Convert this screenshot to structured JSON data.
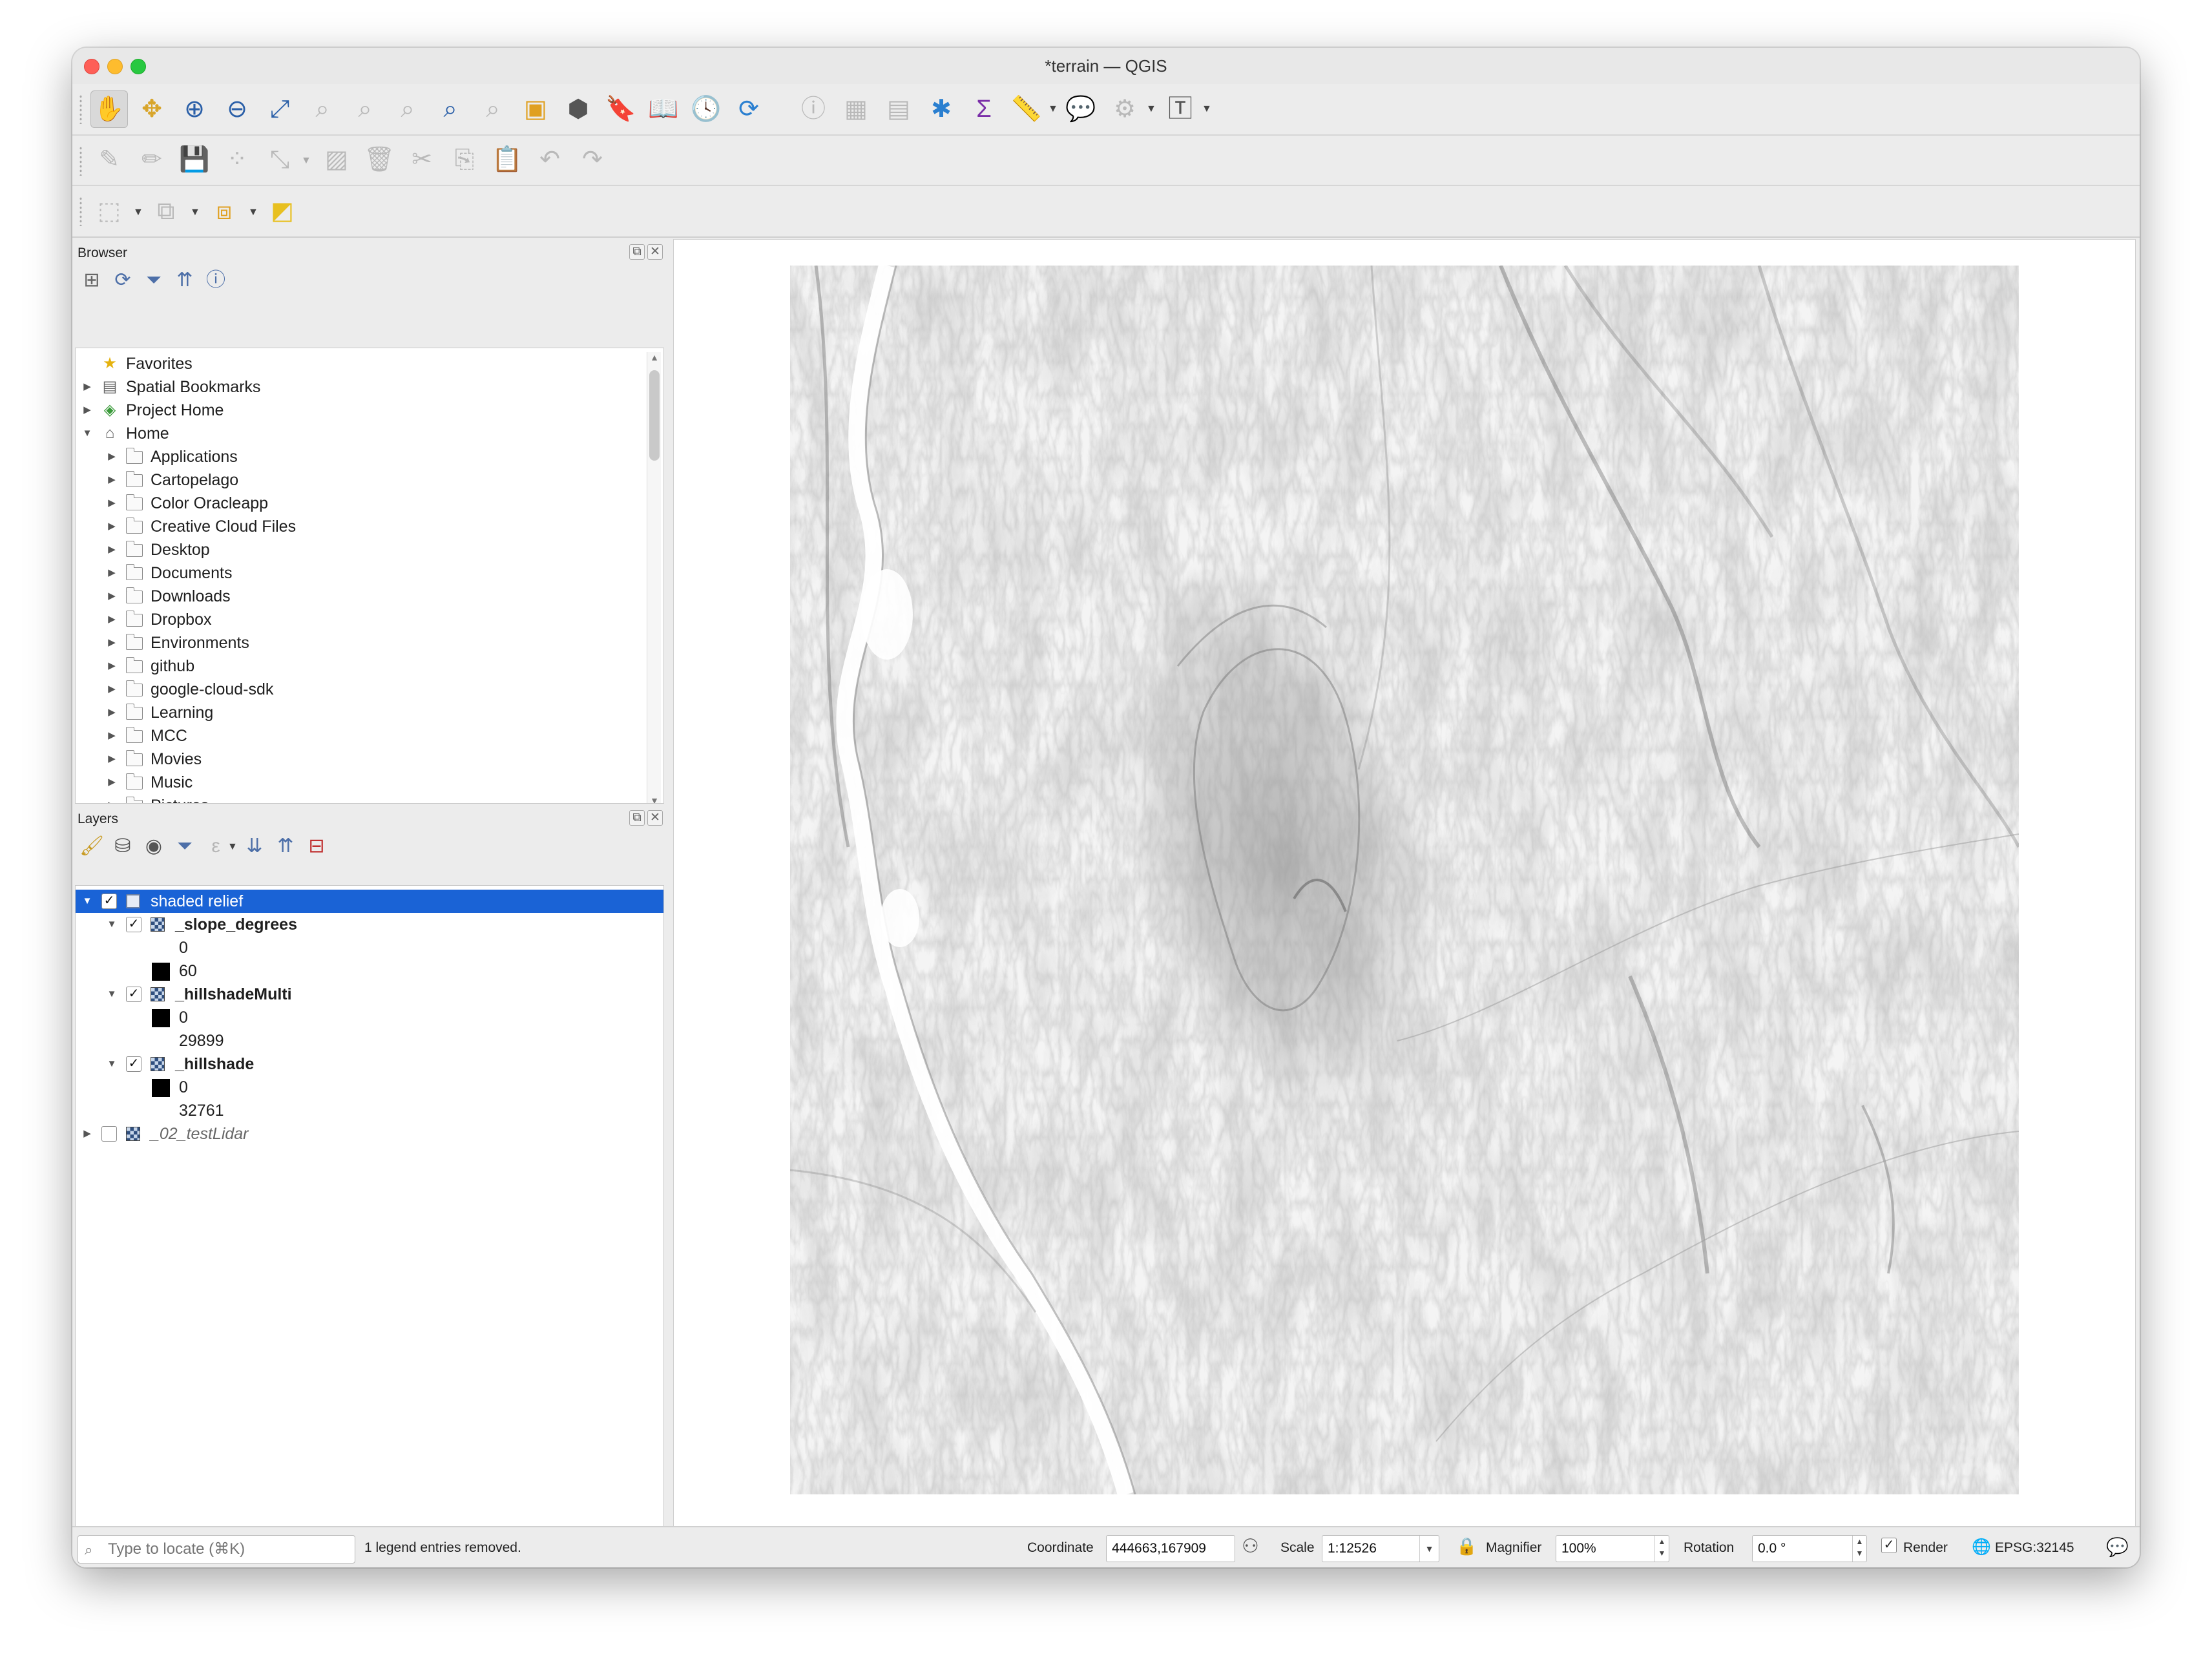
{
  "window": {
    "title": "*terrain — QGIS"
  },
  "browser": {
    "title": "Browser",
    "items": [
      {
        "label": "Favorites",
        "kind": "star",
        "level": 0,
        "expand": ""
      },
      {
        "label": "Spatial Bookmarks",
        "kind": "bookmark",
        "level": 0,
        "expand": "▶"
      },
      {
        "label": "Project Home",
        "kind": "projhome",
        "level": 0,
        "expand": "▶"
      },
      {
        "label": "Home",
        "kind": "home",
        "level": 0,
        "expand": "▼"
      },
      {
        "label": "Applications",
        "kind": "folder",
        "level": 1,
        "expand": "▶"
      },
      {
        "label": "Cartopelago",
        "kind": "folder",
        "level": 1,
        "expand": "▶"
      },
      {
        "label": "Color Oracleapp",
        "kind": "folder",
        "level": 1,
        "expand": "▶"
      },
      {
        "label": "Creative Cloud Files",
        "kind": "folder",
        "level": 1,
        "expand": "▶"
      },
      {
        "label": "Desktop",
        "kind": "folder",
        "level": 1,
        "expand": "▶"
      },
      {
        "label": "Documents",
        "kind": "folder",
        "level": 1,
        "expand": "▶"
      },
      {
        "label": "Downloads",
        "kind": "folder",
        "level": 1,
        "expand": "▶"
      },
      {
        "label": "Dropbox",
        "kind": "folder",
        "level": 1,
        "expand": "▶"
      },
      {
        "label": "Environments",
        "kind": "folder",
        "level": 1,
        "expand": "▶"
      },
      {
        "label": "github",
        "kind": "folder",
        "level": 1,
        "expand": "▶"
      },
      {
        "label": "google-cloud-sdk",
        "kind": "folder",
        "level": 1,
        "expand": "▶"
      },
      {
        "label": "Learning",
        "kind": "folder",
        "level": 1,
        "expand": "▶"
      },
      {
        "label": "MCC",
        "kind": "folder",
        "level": 1,
        "expand": "▶"
      },
      {
        "label": "Movies",
        "kind": "folder",
        "level": 1,
        "expand": "▶"
      },
      {
        "label": "Music",
        "kind": "folder",
        "level": 1,
        "expand": "▶"
      },
      {
        "label": "Pictures",
        "kind": "folder",
        "level": 1,
        "expand": "▶"
      }
    ]
  },
  "layers": {
    "title": "Layers",
    "rows": [
      {
        "label": "shaded relief",
        "type": "group",
        "checked": true,
        "expand": "▼",
        "level": 0,
        "selected": true
      },
      {
        "label": "_slope_degrees",
        "type": "raster",
        "checked": true,
        "expand": "▼",
        "level": 1,
        "bold": true
      },
      {
        "label": "0",
        "type": "legend-white",
        "level": 2
      },
      {
        "label": "60",
        "type": "legend-black",
        "level": 2
      },
      {
        "label": "_hillshadeMulti",
        "type": "raster",
        "checked": true,
        "expand": "▼",
        "level": 1,
        "bold": true
      },
      {
        "label": "0",
        "type": "legend-black",
        "level": 2
      },
      {
        "label": "29899",
        "type": "legend-white",
        "level": 2
      },
      {
        "label": "_hillshade",
        "type": "raster",
        "checked": true,
        "expand": "▼",
        "level": 1,
        "bold": true
      },
      {
        "label": "0",
        "type": "legend-black",
        "level": 2
      },
      {
        "label": "32761",
        "type": "legend-white",
        "level": 2
      },
      {
        "label": "_02_testLidar",
        "type": "raster",
        "checked": false,
        "expand": "▶",
        "level": 0,
        "italic": true
      }
    ]
  },
  "statusbar": {
    "search_placeholder": "Type to locate (⌘K)",
    "message": "1 legend entries removed.",
    "coordinate_label": "Coordinate",
    "coordinate_value": "444663,167909",
    "scale_label": "Scale",
    "scale_value": "1:12526",
    "magnifier_label": "Magnifier",
    "magnifier_value": "100%",
    "rotation_label": "Rotation",
    "rotation_value": "0.0 °",
    "render_label": "Render",
    "crs_label": "EPSG:32145"
  },
  "icons": {
    "toolbar1": [
      "pan-hand-icon",
      "pan-to-selection-icon",
      "zoom-in-icon",
      "zoom-out-icon",
      "zoom-full-icon",
      "zoom-to-selection-icon",
      "zoom-to-layer-icon",
      "zoom-native-icon",
      "zoom-last-icon",
      "zoom-next-icon",
      "new-map-view-icon",
      "new-3d-view-icon",
      "bookmark-icon",
      "show-bookmarks-icon",
      "temporal-controller-icon",
      "refresh-icon",
      "identify-icon",
      "attribute-table-icon",
      "field-calculator-icon",
      "settings-gear-icon",
      "statistics-sigma-icon",
      "measure-icon",
      "map-tips-icon",
      "locator-icon",
      "text-annotation-icon"
    ]
  }
}
